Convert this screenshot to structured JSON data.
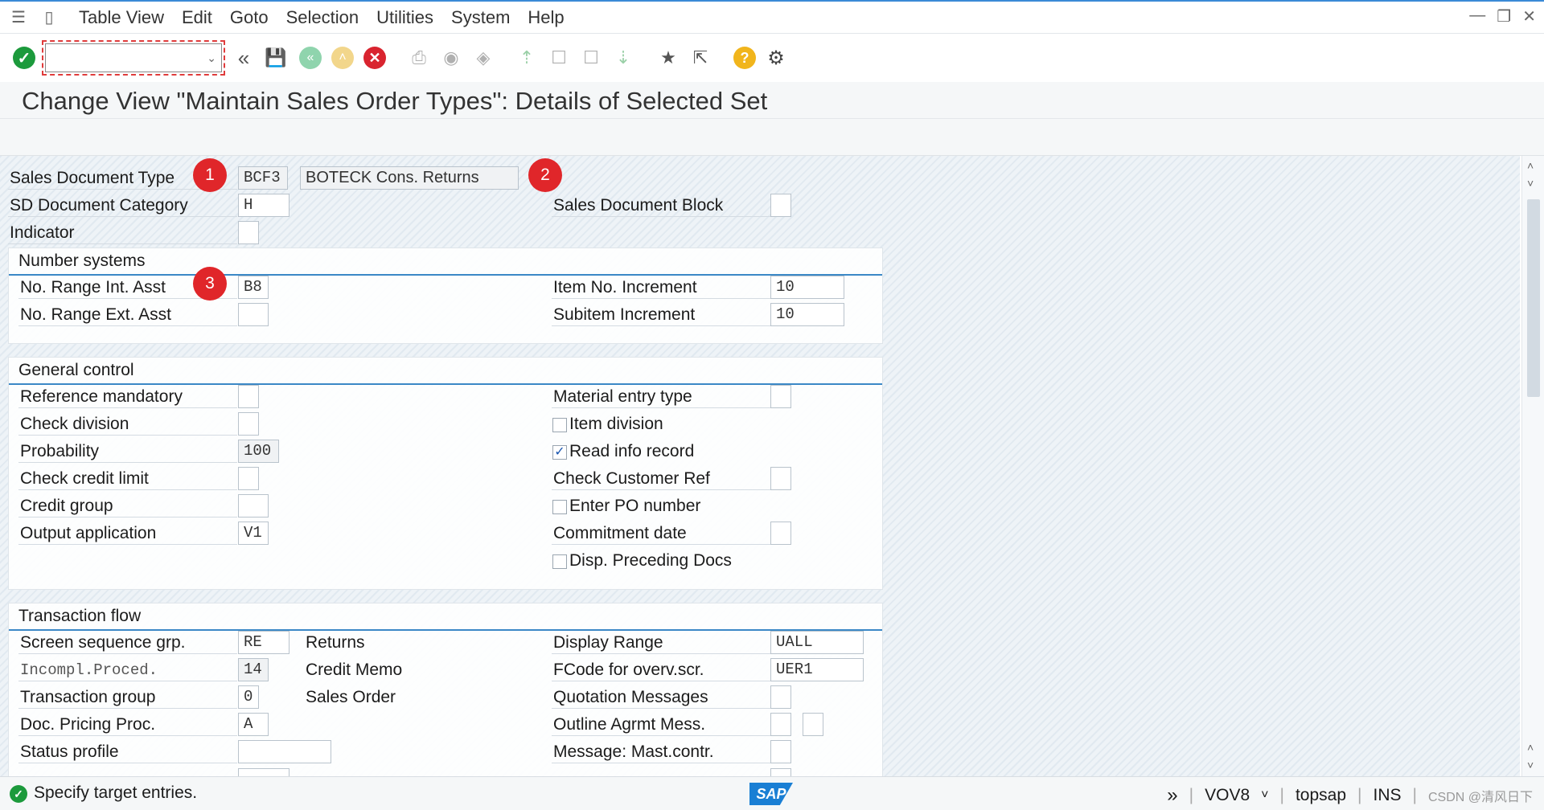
{
  "menu": {
    "items": [
      "Table View",
      "Edit",
      "Goto",
      "Selection",
      "Utilities",
      "System",
      "Help"
    ]
  },
  "icons": {
    "system_menu": "menu-icon",
    "enter": "checkmark-icon",
    "back": "double-left-arrow-icon",
    "save": "save-icon",
    "exit": "exit-icon",
    "up": "up-arrow-icon",
    "cancel": "cancel-icon",
    "print": "print-icon",
    "find": "binoculars-icon",
    "find_next": "binoculars-plus-icon",
    "first_page": "first-page-icon",
    "previous_page": "previous-page-icon",
    "next_page": "next-page-icon",
    "last_page": "last-page-icon",
    "create_session": "new-session-icon",
    "shortcut": "shortcut-icon",
    "help": "help-icon",
    "settings": "gear-icon"
  },
  "toolbar": {
    "command_value": ""
  },
  "title": "Change View \"Maintain Sales Order Types\": Details of Selected Set",
  "header": {
    "sales_document_type_label": "Sales Document Type",
    "sales_document_type_value": "BCF3",
    "sales_document_type_text": "BOTECK Cons. Returns",
    "sd_document_category_label": "SD Document Category",
    "sd_document_category_value": "H",
    "indicator_label": "Indicator",
    "indicator_value": "",
    "sales_document_block_label": "Sales Document Block",
    "sales_document_block_value": ""
  },
  "badges": [
    "1",
    "2",
    "3"
  ],
  "number_systems": {
    "title": "Number systems",
    "no_range_int_label": "No. Range Int. Asst",
    "no_range_int_value": "B8",
    "no_range_ext_label": "No. Range Ext. Asst",
    "no_range_ext_value": "",
    "item_no_increment_label": "Item No. Increment",
    "item_no_increment_value": "10",
    "subitem_increment_label": "Subitem Increment",
    "subitem_increment_value": "10"
  },
  "general_control": {
    "title": "General control",
    "reference_mandatory_label": "Reference mandatory",
    "check_division_label": "Check division",
    "probability_label": "Probability",
    "probability_value": "100",
    "check_credit_limit_label": "Check credit limit",
    "credit_group_label": "Credit group",
    "output_application_label": "Output application",
    "output_application_value": "V1",
    "material_entry_type_label": "Material entry type",
    "item_division_label": "Item division",
    "item_division_checked": false,
    "read_info_record_label": "Read info record",
    "read_info_record_checked": true,
    "check_customer_ref_label": "Check Customer Ref",
    "enter_po_number_label": "Enter PO number",
    "enter_po_number_checked": false,
    "commitment_date_label": "Commitment  date",
    "disp_preceding_docs_label": "Disp. Preceding Docs",
    "disp_preceding_docs_checked": false
  },
  "transaction_flow": {
    "title": "Transaction flow",
    "screen_sequence_label": "Screen sequence grp.",
    "screen_sequence_value": "RE",
    "screen_sequence_text": "Returns",
    "incompl_proced_label": "Incompl.Proced.",
    "incompl_proced_value": "14",
    "incompl_proced_text": "Credit Memo",
    "transaction_group_label": "Transaction group",
    "transaction_group_value": "0",
    "transaction_group_text": "Sales Order",
    "doc_pricing_label": "Doc. Pricing Proc.",
    "doc_pricing_value": "A",
    "status_profile_label": "Status profile",
    "status_profile_value": "",
    "display_range_label": "Display Range",
    "display_range_value": "UALL",
    "fcode_label": "FCode for overv.scr.",
    "fcode_value": "UER1",
    "quotation_messages_label": "Quotation Messages",
    "outline_agrmt_label": "Outline Agrmt Mess.",
    "message_mast_label": "Message: Mast.contr."
  },
  "status": {
    "message": "Specify target entries.",
    "logo": "SAP",
    "transaction": "VOV8",
    "system": "topsap",
    "mode": "INS",
    "watermark": "CSDN @清风日下"
  }
}
